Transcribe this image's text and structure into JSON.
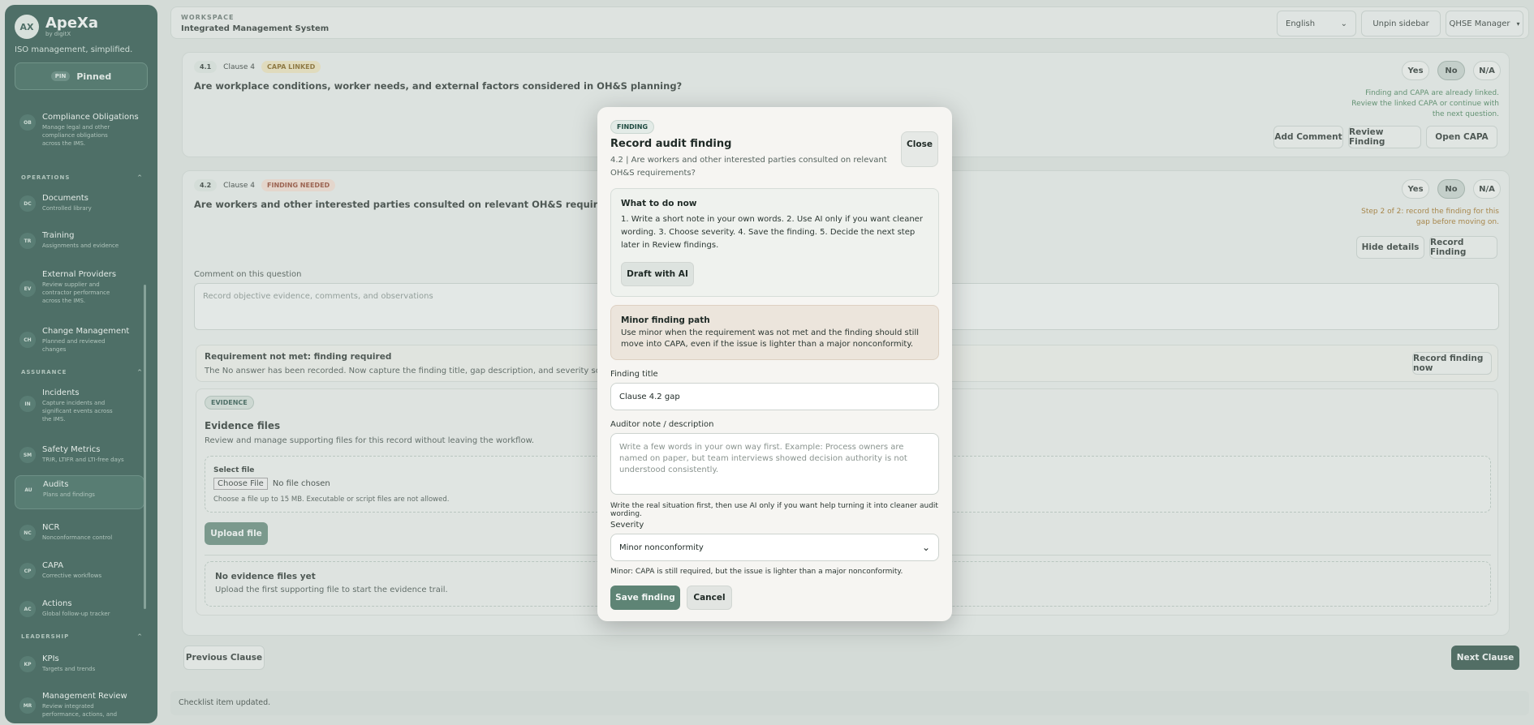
{
  "app": {
    "logo": "AX",
    "name": "ApeXa",
    "by": "by digitX",
    "tagline": "ISO management, simplified.",
    "pinned_tag": "PIN",
    "pinned_label": "Pinned"
  },
  "sidebar": {
    "items": [
      {
        "code": "OB",
        "title": "Compliance Obligations",
        "desc": "Manage legal and other compliance obligations across the IMS."
      },
      {
        "code": "DC",
        "title": "Documents",
        "desc": "Controlled library"
      },
      {
        "code": "TR",
        "title": "Training",
        "desc": "Assignments and evidence"
      },
      {
        "code": "EV",
        "title": "External Providers",
        "desc": "Review supplier and contractor performance across the IMS."
      },
      {
        "code": "CH",
        "title": "Change Management",
        "desc": "Planned and reviewed changes"
      },
      {
        "code": "IN",
        "title": "Incidents",
        "desc": "Capture incidents and significant events across the IMS."
      },
      {
        "code": "SM",
        "title": "Safety Metrics",
        "desc": "TRIR, LTIFR and LTI-free days"
      },
      {
        "code": "AU",
        "title": "Audits",
        "desc": "Plans and findings"
      },
      {
        "code": "NC",
        "title": "NCR",
        "desc": "Nonconformance control"
      },
      {
        "code": "CP",
        "title": "CAPA",
        "desc": "Corrective workflows"
      },
      {
        "code": "AC",
        "title": "Actions",
        "desc": "Global follow-up tracker"
      },
      {
        "code": "KP",
        "title": "KPIs",
        "desc": "Targets and trends"
      },
      {
        "code": "MR",
        "title": "Management Review",
        "desc": "Review integrated performance, actions, and"
      }
    ],
    "sections": [
      "OPERATIONS",
      "ASSURANCE",
      "LEADERSHIP"
    ],
    "collapse_glyph": "^"
  },
  "topbar": {
    "label": "WORKSPACE",
    "title": "Integrated Management System",
    "language": "English",
    "unpin": "Unpin sidebar",
    "role": "QHSE Manager"
  },
  "q1": {
    "num": "4.1",
    "clause": "Clause 4",
    "tag": "CAPA LINKED",
    "text": "Are workplace conditions, worker needs, and external factors considered in OH&S planning?",
    "note": "Finding and CAPA are already linked. Review the linked CAPA or continue with the next question.",
    "add_comment": "Add Comment",
    "review": "Review Finding",
    "open_capa": "Open CAPA"
  },
  "answers": {
    "yes": "Yes",
    "no": "No",
    "na": "N/A"
  },
  "q2": {
    "num": "4.2",
    "clause": "Clause 4",
    "tag": "FINDING NEEDED",
    "text": "Are workers and other interested parties consulted on relevant OH&S requirements?",
    "note": "Step 2 of 2: record the finding for this gap before moving on.",
    "hide": "Hide details",
    "record": "Record Finding",
    "comment_label": "Comment on this question",
    "comment_placeholder": "Record objective evidence, comments, and observations",
    "req_title": "Requirement not met: finding required",
    "req_text": "The No answer has been recorded. Now capture the finding title, gap description, and severity so the revie",
    "record_now": "Record finding now",
    "ev_tag": "EVIDENCE",
    "ev_title": "Evidence files",
    "ev_desc": "Review and manage supporting files for this record without leaving the workflow.",
    "select_file": "Select file",
    "choose": "Choose File",
    "no_file": "No file chosen",
    "file_help": "Choose a file up to 15 MB. Executable or script files are not allowed.",
    "upload": "Upload file",
    "empty_title": "No evidence files yet",
    "empty_text": "Upload the first supporting file to start the evidence trail."
  },
  "footer": {
    "prev": "Previous Clause",
    "next": "Next Clause",
    "status": "Checklist item updated."
  },
  "modal": {
    "tag": "FINDING",
    "title": "Record audit finding",
    "subtitle": "4.2 | Are workers and other interested parties consulted on relevant OH&S requirements?",
    "close": "Close",
    "todo_title": "What to do now",
    "todo_text": "1. Write a short note in your own words. 2. Use AI only if you want cleaner wording. 3. Choose severity. 4. Save the finding. 5. Decide the next step later in Review findings.",
    "draft": "Draft with AI",
    "path_title": "Minor finding path",
    "path_text": "Use minor when the requirement was not met and the finding should still move into CAPA, even if the issue is lighter than a major nonconformity.",
    "title_label": "Finding title",
    "title_value": "Clause 4.2 gap",
    "note_label": "Auditor note / description",
    "note_placeholder": "Write a few words in your own way first. Example: Process owners are named on paper, but team interviews showed decision authority is not understood consistently.",
    "note_help": "Write the real situation first, then use AI only if you want help turning it into cleaner audit wording.",
    "severity_label": "Severity",
    "severity_value": "Minor nonconformity",
    "severity_help": "Minor: CAPA is still required, but the issue is lighter than a major nonconformity.",
    "save": "Save finding",
    "cancel": "Cancel"
  },
  "colors": {
    "sidebar": "#1f4a40",
    "accent": "#5e8475",
    "capa_tag": "#e9dfb8",
    "finding_tag": "#efd8cc",
    "note_green": "#3d7a52",
    "note_amber": "#9a6a1a"
  }
}
